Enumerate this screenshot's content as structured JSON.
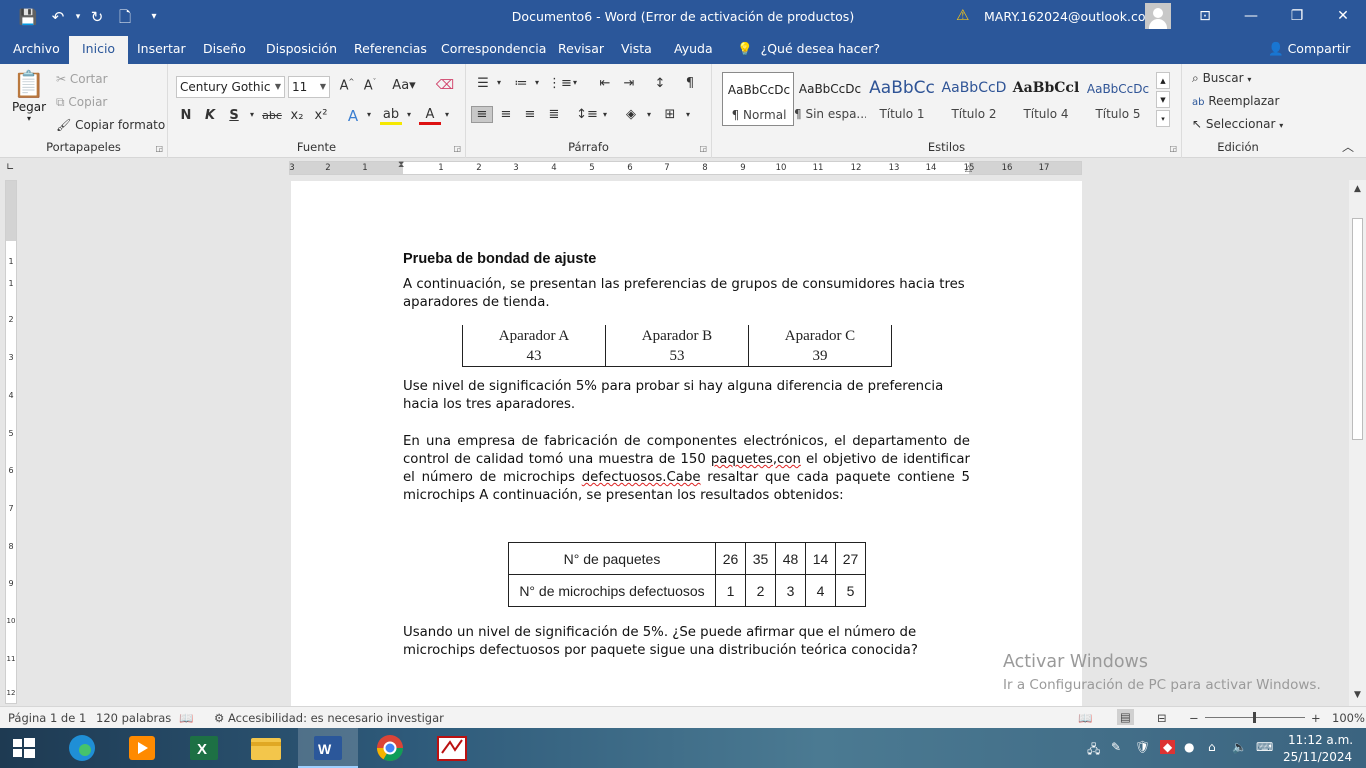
{
  "window": {
    "title": "Documento6  -  Word (Error de activación de productos)",
    "account": "MARY.162024@outlook.com",
    "warning_glyph": "⚠",
    "minimize_glyph": "—",
    "restore_glyph": "❐",
    "close_glyph": "✕",
    "ribbon_display_glyph": "⊡"
  },
  "quick_access": {
    "save_glyph": "💾",
    "undo_glyph": "↶",
    "redo_glyph": "↻",
    "new_glyph": "🗋",
    "more_glyph": "▾"
  },
  "tabs": [
    {
      "label": "Archivo"
    },
    {
      "label": "Inicio"
    },
    {
      "label": "Insertar"
    },
    {
      "label": "Diseño"
    },
    {
      "label": "Disposición"
    },
    {
      "label": "Referencias"
    },
    {
      "label": "Correspondencia"
    },
    {
      "label": "Revisar"
    },
    {
      "label": "Vista"
    },
    {
      "label": "Ayuda"
    }
  ],
  "help_search": "¿Qué desea hacer?",
  "share": "Compartir",
  "ribbon": {
    "clipboard": {
      "paste": "Pegar",
      "cut": "Cortar",
      "copy": "Copiar",
      "format_painter": "Copiar formato",
      "label": "Portapapeles"
    },
    "font": {
      "name": "Century Gothic",
      "size": "11",
      "bold": "N",
      "italic": "K",
      "underline": "S",
      "strike": "abc",
      "sub": "x₂",
      "sup": "x²",
      "label": "Fuente"
    },
    "paragraph": {
      "label": "Párrafo"
    },
    "styles": {
      "label": "Estilos",
      "items": [
        {
          "sample": "AaBbCcDc",
          "name": "¶ Normal"
        },
        {
          "sample": "AaBbCcDc",
          "name": "¶ Sin espa..."
        },
        {
          "sample": "AaBbCc",
          "name": "Título 1"
        },
        {
          "sample": "AaBbCcD",
          "name": "Título 2"
        },
        {
          "sample": "AaBbCcl",
          "name": "Título 4"
        },
        {
          "sample": "AaBbCcDc",
          "name": "Título 5"
        }
      ]
    },
    "editing": {
      "find": "Buscar",
      "replace": "Reemplazar",
      "select": "Seleccionar",
      "label": "Edición"
    }
  },
  "ruler": {
    "h_numbers": [
      "3",
      "2",
      "1",
      "1",
      "2",
      "3",
      "4",
      "5",
      "6",
      "7",
      "8",
      "9",
      "10",
      "11",
      "12",
      "13",
      "14",
      "15",
      "16",
      "17"
    ],
    "v_numbers": [
      "1",
      "1",
      "2",
      "3",
      "4",
      "5",
      "6",
      "7",
      "8",
      "9",
      "10",
      "11",
      "12"
    ]
  },
  "document": {
    "heading": "Prueba de bondad de ajuste",
    "p1": "A continuación, se presentan las preferencias de grupos de consumidores hacia tres aparadores de tienda.",
    "table1": {
      "headers": [
        "Aparador A",
        "Aparador B",
        "Aparador C"
      ],
      "values": [
        "43",
        "53",
        "39"
      ]
    },
    "p2": "Use nivel de significación 5% para probar si hay alguna diferencia de preferencia hacia los tres aparadores.",
    "p3": {
      "a": "En una empresa de fabricación de componentes electrónicos, el departamento de control de calidad tomó una muestra de 150 ",
      "err1": "paquetes,con",
      "b": " el objetivo de identificar el número de microchips ",
      "err2": "defectuosos.Cabe",
      "c": " resaltar que cada paquete contiene 5 microchips A continuación, se presentan los resultados obtenidos:"
    },
    "table2": {
      "row1_label": "N° de paquetes",
      "row1": [
        "26",
        "35",
        "48",
        "14",
        "27"
      ],
      "row2_label": "N° de microchips defectuosos",
      "row2": [
        "1",
        "2",
        "3",
        "4",
        "5"
      ]
    },
    "p4": "Usando un nivel de significación de 5%. ¿Se puede afirmar que el número de microchips defectuosos por paquete sigue una distribución teórica conocida?"
  },
  "watermark": {
    "title": "Activar Windows",
    "subtitle": "Ir a Configuración de PC para activar Windows."
  },
  "status": {
    "page": "Página 1 de 1",
    "words": "120 palabras",
    "accessibility": "Accesibilidad: es necesario investigar",
    "zoom": "100%"
  },
  "taskbar": {
    "time": "11:12 a.m.",
    "date": "25/11/2024"
  }
}
